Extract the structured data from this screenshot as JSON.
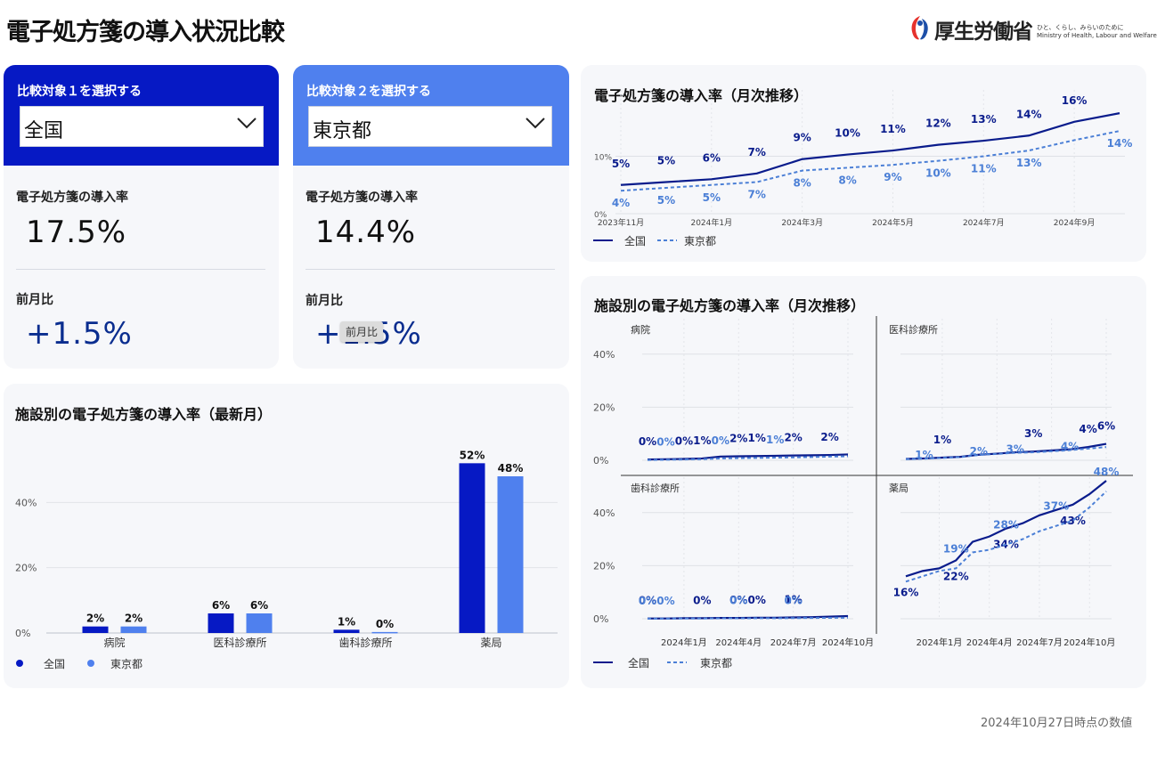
{
  "page": {
    "title": "電子処方箋の導入状況比較",
    "footer": "2024年10月27日時点の数値"
  },
  "logo": {
    "name": "厚生労働省",
    "tagline_ja": "ひと、くらし、みらいのために",
    "tagline_en": "Ministry of Health, Labour and Welfare"
  },
  "colors": {
    "dark": "#0619c4",
    "light": "#4f80ee",
    "line_dark": "#0a1c8c",
    "line_light": "#4b7fd6",
    "card1_header": "#0619c4",
    "card2_header": "#4f80ee"
  },
  "compare1": {
    "label": "比較対象１を選択する",
    "selected": "全国",
    "rate_label": "電子処方箋の導入率",
    "rate": "17.5%",
    "mom_label": "前月比",
    "mom": "+1.5%"
  },
  "compare2": {
    "label": "比較対象２を選択する",
    "selected": "東京都",
    "rate_label": "電子処方箋の導入率",
    "rate": "14.4%",
    "mom_label": "前月比",
    "mom": "+1.5%",
    "tooltip": "前月比"
  },
  "legend": {
    "s1": "全国",
    "s2": "東京都"
  },
  "panels": {
    "bar_title": "施設別の電子処方箋の導入率（最新月）",
    "monthly_title": "電子処方箋の導入率（月次推移）",
    "facility_title": "施設別の電子処方箋の導入率（月次推移）"
  },
  "chart_data": [
    {
      "type": "bar",
      "categories": [
        "病院",
        "医科診療所",
        "歯科診療所",
        "薬局"
      ],
      "series": [
        {
          "name": "全国",
          "values": [
            2,
            6,
            1,
            52
          ],
          "labels": [
            "2%",
            "6%",
            "1%",
            "52%"
          ]
        },
        {
          "name": "東京都",
          "values": [
            2,
            6,
            0.3,
            48
          ],
          "labels": [
            "2%",
            "6%",
            "0%",
            "48%"
          ]
        }
      ],
      "yticks": [
        "0%",
        "20%",
        "40%"
      ],
      "ylim": [
        0,
        60
      ]
    },
    {
      "type": "line",
      "x": [
        "2023年11月",
        "2023年12月",
        "2024年1月",
        "2024年2月",
        "2024年3月",
        "2024年4月",
        "2024年5月",
        "2024年6月",
        "2024年7月",
        "2024年8月",
        "2024年9月",
        "2024年10月"
      ],
      "xticks": [
        "2023年11月",
        "2024年1月",
        "2024年3月",
        "2024年5月",
        "2024年7月",
        "2024年9月"
      ],
      "yticks": [
        "0%",
        "10%"
      ],
      "ylim": [
        0,
        20
      ],
      "series": [
        {
          "name": "全国",
          "values": [
            5,
            5.5,
            6,
            7,
            9.5,
            10.3,
            11,
            12,
            12.7,
            13.6,
            16,
            17.5
          ],
          "labels": [
            "5%",
            "5%",
            "6%",
            "7%",
            "9%",
            "10%",
            "11%",
            "12%",
            "13%",
            "14%",
            "16%"
          ]
        },
        {
          "name": "東京都",
          "values": [
            4,
            4.5,
            5,
            5.5,
            7.5,
            8,
            8.5,
            9.2,
            10,
            11,
            12.8,
            14.4
          ],
          "labels": [
            "4%",
            "5%",
            "5%",
            "7%",
            "8%",
            "8%",
            "9%",
            "10%",
            "11%",
            "13%",
            "14%"
          ]
        }
      ]
    },
    {
      "type": "line",
      "title": "病院",
      "x": [
        "2023年11月",
        "2023年12月",
        "2024年1月",
        "2024年2月",
        "2024年3月",
        "2024年4月",
        "2024年5月",
        "2024年6月",
        "2024年7月",
        "2024年8月",
        "2024年9月",
        "2024年10月"
      ],
      "yticks": [
        "0%",
        "20%",
        "40%"
      ],
      "ylim": [
        0,
        50
      ],
      "series": [
        {
          "name": "全国",
          "values": [
            0.3,
            0.4,
            0.5,
            0.7,
            1.4,
            1.5,
            1.6,
            1.7,
            1.8,
            1.9,
            2.0,
            2.2
          ],
          "labels": [
            "0%",
            "0%",
            "1%",
            "2%",
            "1%",
            "2%",
            "2%"
          ]
        },
        {
          "name": "東京都",
          "values": [
            0.1,
            0.2,
            0.3,
            0.4,
            0.7,
            0.8,
            0.9,
            1.0,
            1.1,
            1.2,
            1.4,
            1.5
          ],
          "labels": [
            "0%",
            "0%",
            "1%"
          ]
        }
      ]
    },
    {
      "type": "line",
      "title": "医科診療所",
      "x": [
        "2023年11月",
        "2023年12月",
        "2024年1月",
        "2024年2月",
        "2024年3月",
        "2024年4月",
        "2024年5月",
        "2024年6月",
        "2024年7月",
        "2024年8月",
        "2024年9月",
        "2024年10月"
      ],
      "xticks": [
        "2024年1月",
        "2024年4月",
        "2024年7月",
        "2024年10月"
      ],
      "yticks": [
        "0%",
        "20%",
        "40%"
      ],
      "ylim": [
        0,
        50
      ],
      "series": [
        {
          "name": "全国",
          "values": [
            0.5,
            0.7,
            1,
            1.3,
            2.1,
            2.5,
            3,
            3.3,
            3.7,
            4.1,
            5,
            6.2
          ],
          "labels": [
            "1%",
            "3%",
            "4%",
            "6%"
          ]
        },
        {
          "name": "東京都",
          "values": [
            0.4,
            0.6,
            0.9,
            1.2,
            2.0,
            2.4,
            2.8,
            3.0,
            3.4,
            3.8,
            4.4,
            5.0
          ],
          "labels": [
            "1%",
            "2%",
            "3%",
            "4%"
          ]
        }
      ]
    },
    {
      "type": "line",
      "title": "歯科診療所",
      "x": [
        "2023年11月",
        "2023年12月",
        "2024年1月",
        "2024年2月",
        "2024年3月",
        "2024年4月",
        "2024年5月",
        "2024年6月",
        "2024年7月",
        "2024年8月",
        "2024年9月",
        "2024年10月"
      ],
      "xticks": [
        "2024年1月",
        "2024年4月",
        "2024年7月",
        "2024年10月"
      ],
      "yticks": [
        "0%",
        "20%",
        "40%"
      ],
      "ylim": [
        0,
        50
      ],
      "series": [
        {
          "name": "全国",
          "values": [
            0.1,
            0.1,
            0.2,
            0.2,
            0.3,
            0.3,
            0.4,
            0.4,
            0.5,
            0.6,
            0.8,
            1.0
          ],
          "labels": [
            "0%",
            "0%",
            "0%",
            "0%",
            "1%"
          ]
        },
        {
          "name": "東京都",
          "values": [
            0.05,
            0.05,
            0.1,
            0.1,
            0.15,
            0.15,
            0.2,
            0.2,
            0.25,
            0.3,
            0.35,
            0.4
          ],
          "labels": [
            "0%",
            "0%",
            "0%",
            "0%"
          ]
        }
      ]
    },
    {
      "type": "line",
      "title": "薬局",
      "x": [
        "2023年11月",
        "2023年12月",
        "2024年1月",
        "2024年2月",
        "2024年3月",
        "2024年4月",
        "2024年5月",
        "2024年6月",
        "2024年7月",
        "2024年8月",
        "2024年9月",
        "2024年10月"
      ],
      "xticks": [
        "2024年1月",
        "2024年4月",
        "2024年7月",
        "2024年10月"
      ],
      "yticks": [
        "0%",
        "20%",
        "40%"
      ],
      "ylim": [
        0,
        50
      ],
      "series": [
        {
          "name": "全国",
          "values": [
            16,
            18,
            19,
            22,
            29,
            31,
            34,
            36,
            39,
            41,
            43,
            47,
            52
          ],
          "labels": [
            "16%",
            "22%",
            "34%",
            "43%"
          ]
        },
        {
          "name": "東京都",
          "values": [
            14,
            16,
            18,
            19,
            25,
            26,
            28,
            30,
            33,
            35,
            37,
            42,
            48
          ],
          "labels": [
            "19%",
            "28%",
            "37%",
            "48%"
          ]
        }
      ]
    }
  ]
}
